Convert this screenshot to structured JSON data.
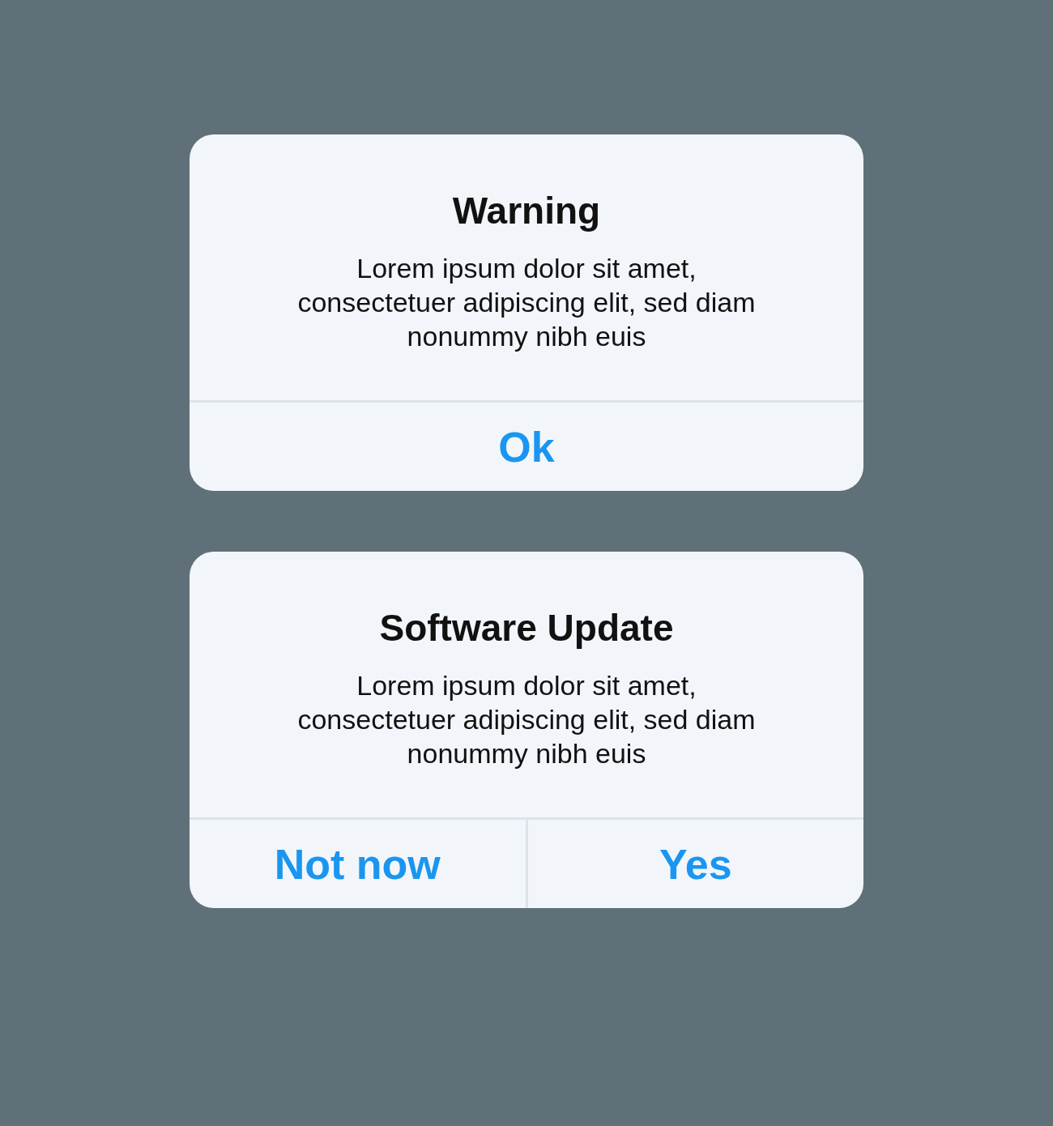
{
  "dialogs": [
    {
      "title": "Warning",
      "message": "Lorem ipsum dolor sit amet, consectetuer adipiscing elit, sed diam nonummy nibh euis",
      "buttons": [
        {
          "label": "Ok"
        }
      ]
    },
    {
      "title": "Software Update",
      "message": "Lorem ipsum dolor sit amet, consectetuer adipiscing elit, sed diam nonummy nibh euis",
      "buttons": [
        {
          "label": "Not now"
        },
        {
          "label": "Yes"
        }
      ]
    }
  ]
}
